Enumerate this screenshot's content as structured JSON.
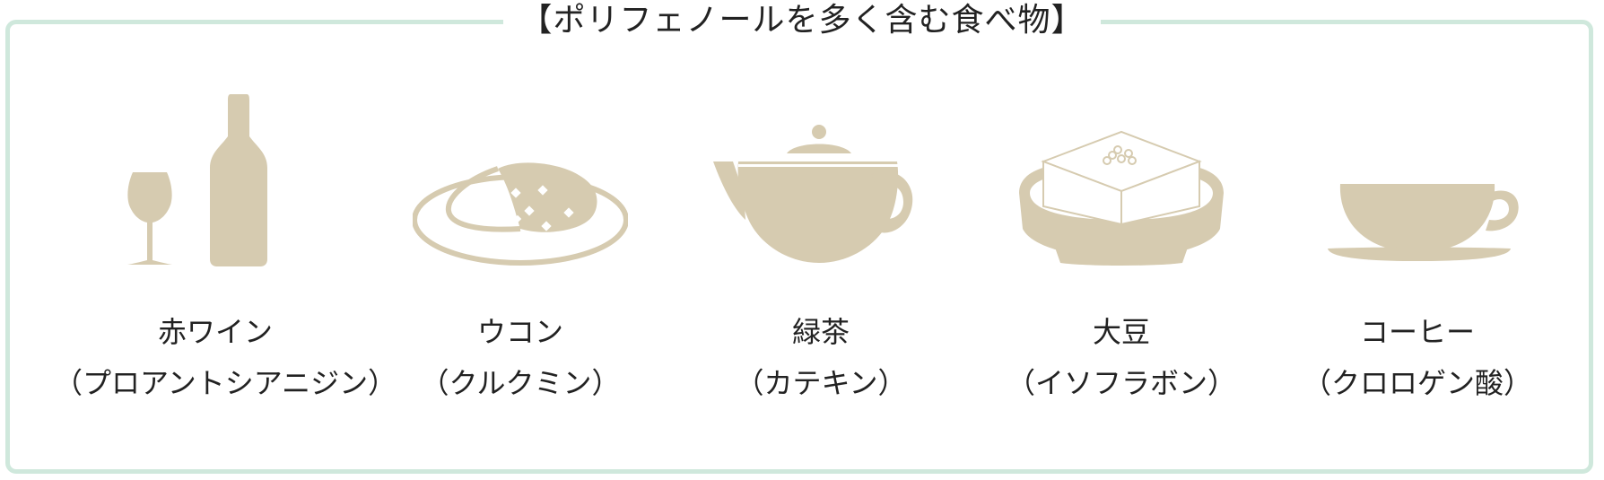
{
  "title": "【ポリフェノールを多く含む食べ物】",
  "colors": {
    "frame": "#cfe8dc",
    "icon": "#d6cbb0",
    "text": "#222222"
  },
  "items": [
    {
      "name": "赤ワイン",
      "compound": "（プロアントシアニジン）",
      "icon": "wine-icon"
    },
    {
      "name": "ウコン",
      "compound": "（クルクミン）",
      "icon": "curry-icon"
    },
    {
      "name": "緑茶",
      "compound": "（カテキン）",
      "icon": "teapot-icon"
    },
    {
      "name": "大豆",
      "compound": "（イソフラボン）",
      "icon": "tofu-icon"
    },
    {
      "name": "コーヒー",
      "compound": "（クロロゲン酸）",
      "icon": "coffee-cup-icon"
    }
  ]
}
